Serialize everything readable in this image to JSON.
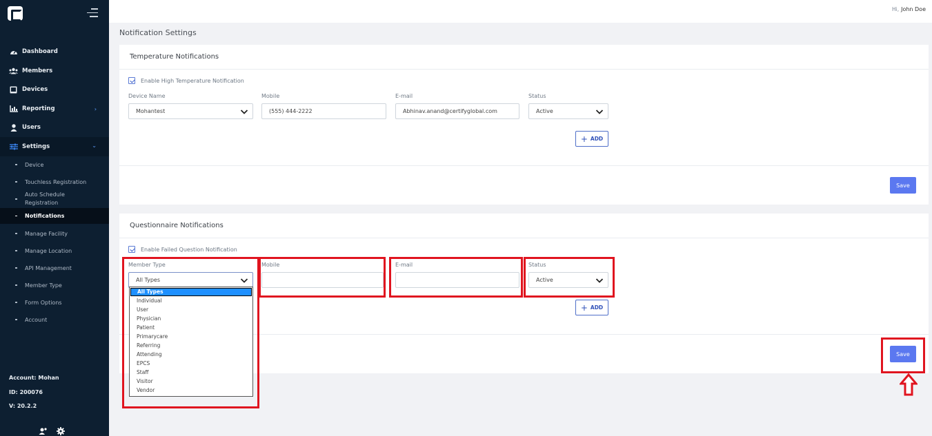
{
  "header": {
    "greeting_prefix": "Hi,",
    "user_name": "John Doe"
  },
  "page_title": "Notification Settings",
  "sidebar": {
    "items": [
      {
        "label": "Dashboard",
        "icon": "dashboard-icon"
      },
      {
        "label": "Members",
        "icon": "members-icon"
      },
      {
        "label": "Devices",
        "icon": "tablet-icon"
      },
      {
        "label": "Reporting",
        "icon": "chart-icon",
        "arrow": "›"
      },
      {
        "label": "Users",
        "icon": "user-icon"
      },
      {
        "label": "Settings",
        "icon": "sliders-icon",
        "arrow": "⌄"
      }
    ],
    "subitems": [
      {
        "label": "Device"
      },
      {
        "label": "Touchless Registration"
      },
      {
        "label": "Auto Schedule Registration"
      },
      {
        "label": "Notifications"
      },
      {
        "label": "Manage Facility"
      },
      {
        "label": "Manage Location"
      },
      {
        "label": "API Management"
      },
      {
        "label": "Member Type"
      },
      {
        "label": "Form Options"
      },
      {
        "label": "Account"
      }
    ],
    "account": {
      "account_line": "Account: Mohan",
      "id_line": "ID: 200076",
      "version_line": "V: 20.2.2"
    }
  },
  "temperature": {
    "title": "Temperature Notifications",
    "checkbox_label": "Enable High Temperature Notification",
    "labels": {
      "device": "Device Name",
      "mobile": "Mobile",
      "email": "E-mail",
      "status": "Status"
    },
    "values": {
      "device": "Mohantest",
      "mobile": "(555) 444-2222",
      "email": "Abhinav.anand@certifyglobal.com",
      "status": "Active"
    },
    "add_label": "ADD",
    "save_label": "Save"
  },
  "questionnaire": {
    "title": "Questionnaire Notifications",
    "checkbox_label": "Enable Failed Question Notification",
    "labels": {
      "member_type": "Member Type",
      "mobile": "Mobile",
      "email": "E-mail",
      "status": "Status"
    },
    "values": {
      "member_type": "All Types",
      "mobile": "",
      "email": "",
      "status": "Active"
    },
    "add_label": "ADD",
    "save_label": "Save",
    "member_type_options": [
      "All Types",
      "Individual",
      "User",
      "Physician",
      "Patient",
      "Primarycare",
      "Referring",
      "Attending",
      "EPCS",
      "Staff",
      "Visitor",
      "Vendor"
    ]
  },
  "colors": {
    "sidebar_bg": "#0d1f31",
    "accent": "#5b78f0",
    "annotation": "#e0141f",
    "selected_option": "#1e90ff"
  }
}
